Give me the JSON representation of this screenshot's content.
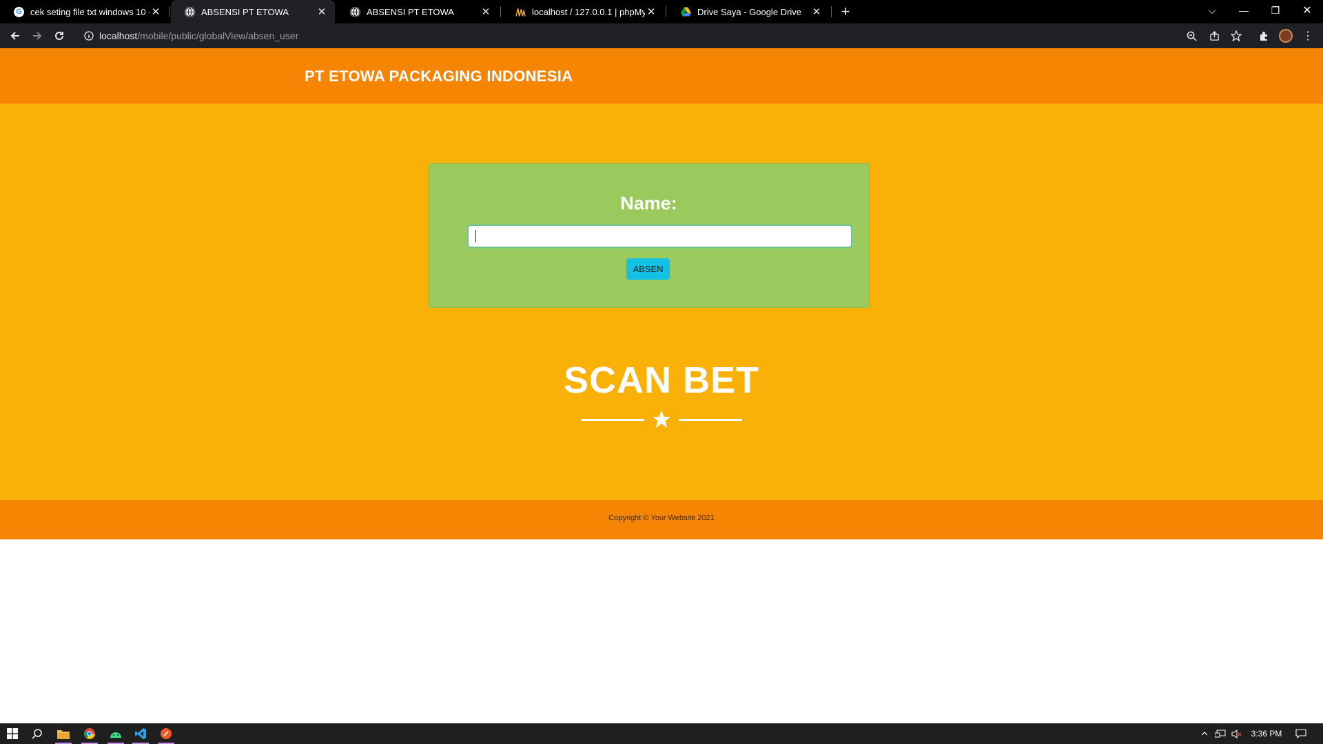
{
  "browser": {
    "tabs": [
      {
        "title": "cek seting file txt windows 10 - P",
        "favicon": "google-icon",
        "active": false
      },
      {
        "title": "ABSENSI PT ETOWA",
        "favicon": "globe-icon",
        "active": true
      },
      {
        "title": "ABSENSI PT ETOWA",
        "favicon": "globe-icon",
        "active": false
      },
      {
        "title": "localhost / 127.0.0.1 | phpMyAdm",
        "favicon": "phpmyadmin-icon",
        "active": false
      },
      {
        "title": "Drive Saya - Google Drive",
        "favicon": "google-drive-icon",
        "active": false
      }
    ],
    "url_host": "localhost",
    "url_path": "/mobile/public/globalView/absen_user"
  },
  "site": {
    "brand": "PT ETOWA PACKAGING INDONESIA",
    "form": {
      "label": "Name:",
      "input_value": "",
      "submit_label": "ABSEN"
    },
    "hero_title": "SCAN BET",
    "footer": "Copyright © Your Website 2021"
  },
  "taskbar": {
    "clock": "3:36 PM"
  },
  "colors": {
    "header_orange": "#f78504",
    "main_yellow": "#f9b108",
    "card_green": "#9aca5e",
    "button_cyan": "#12c1e4"
  }
}
